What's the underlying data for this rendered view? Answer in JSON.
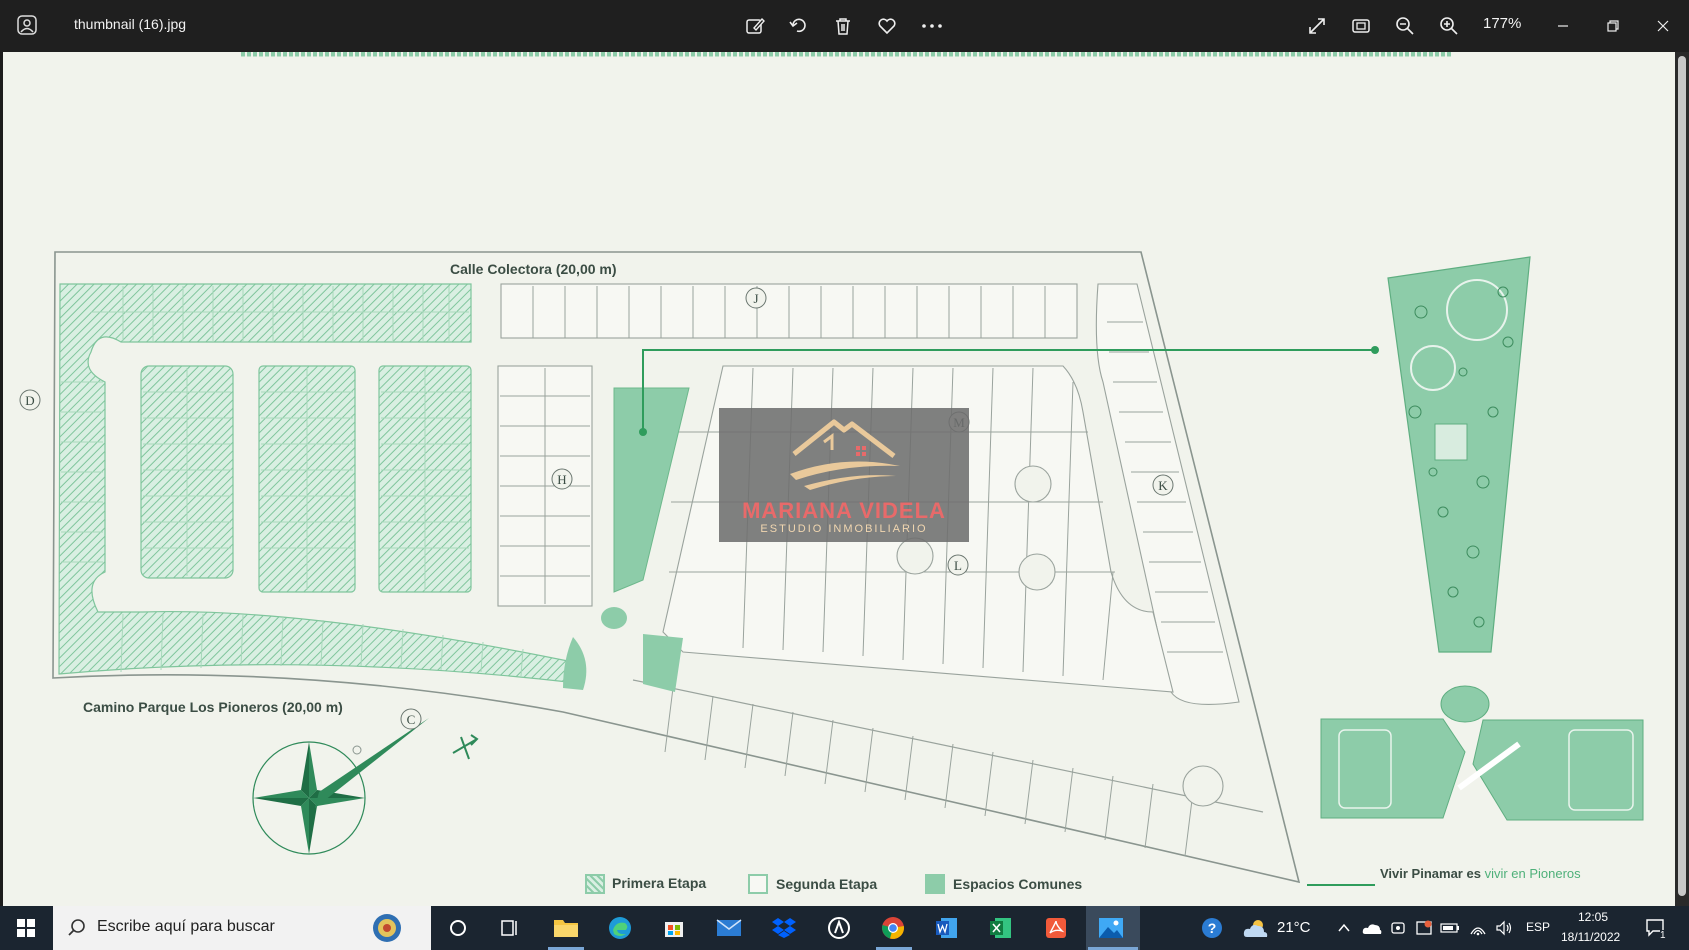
{
  "window": {
    "title": "thumbnail (16).jpg",
    "zoom_level": "177%"
  },
  "toolbar": {
    "icons": [
      "edit-image-icon",
      "rotate-icon",
      "delete-icon",
      "favorite-icon",
      "more-options-icon"
    ],
    "right_icons": [
      "fullscreen-icon",
      "fit-to-window-icon",
      "zoom-out-icon",
      "zoom-in-icon"
    ],
    "window_controls": [
      "minimize-icon",
      "restore-icon",
      "close-icon"
    ]
  },
  "map": {
    "street_top": "Calle Colectora (20,00 m)",
    "street_bottom": "Camino Parque Los Pioneros (20,00 m)",
    "block_letters": [
      "J",
      "D",
      "H",
      "M",
      "K",
      "L",
      "C"
    ],
    "legend": {
      "primera": "Primera Etapa",
      "segunda": "Segunda Etapa",
      "espacios": "Espacios Comunes"
    },
    "slogan_prefix": "Vivir Pinamar es",
    "slogan_highlight": "vivir en Pioneros",
    "colors": {
      "accent_green": "#8dcca9",
      "line_green": "#2f9c5c",
      "lot_line": "#9aa39d"
    }
  },
  "watermark": {
    "name": "MARIANA VIDELA",
    "subtitle": "ESTUDIO INMOBILIARIO"
  },
  "taskbar": {
    "search_placeholder": "Escribe aquí para buscar",
    "apps": [
      "task-view-icon",
      "widgets-icon",
      "file-explorer-icon",
      "edge-icon",
      "store-icon",
      "mail-icon",
      "dropbox-icon",
      "app-icon",
      "chrome-icon",
      "word-icon",
      "excel-icon",
      "acrobat-icon",
      "photos-icon"
    ],
    "weather": "21°C",
    "language": "ESP",
    "time": "12:05",
    "date": "18/11/2022",
    "notification_count": "1"
  }
}
